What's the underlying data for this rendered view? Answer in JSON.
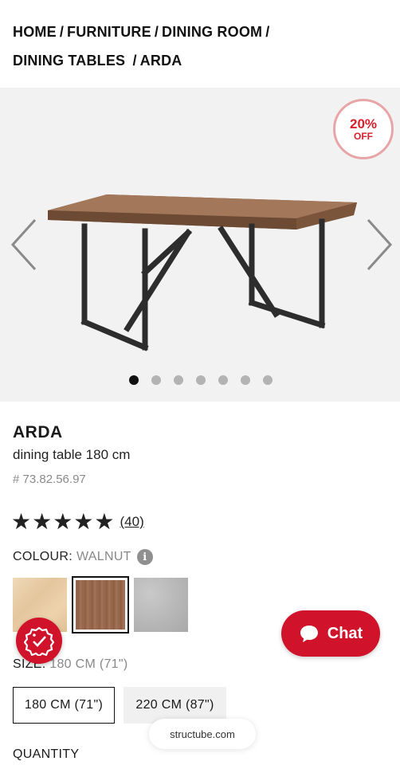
{
  "breadcrumb": {
    "items": [
      "HOME",
      "FURNITURE",
      "DINING ROOM",
      "DINING TABLES",
      "ARDA"
    ],
    "separator": "/"
  },
  "gallery": {
    "discount_badge": {
      "percent": "20%",
      "label": "OFF",
      "color": "#d81f2a"
    },
    "image_count": 7,
    "active_index": 0,
    "prev_icon": "chevron-left-icon",
    "next_icon": "chevron-right-icon"
  },
  "product": {
    "name": "ARDA",
    "description": "dining table 180 cm",
    "sku": "# 73.82.56.97",
    "rating": {
      "stars": "★★★★★",
      "value": 5,
      "reviews": "(40)"
    }
  },
  "colour": {
    "label": "COLOUR:",
    "selected": "WALNUT",
    "info_icon": "info-icon",
    "swatches": [
      {
        "name": "oak",
        "selected": false
      },
      {
        "name": "walnut",
        "selected": true
      },
      {
        "name": "concrete",
        "selected": false
      }
    ]
  },
  "size": {
    "label": "SIZE:",
    "selected": "180 CM (71\")",
    "options": [
      "180 CM (71\")",
      "220 CM (87\")"
    ]
  },
  "quantity": {
    "label": "QUANTITY"
  },
  "chat": {
    "label": "Chat",
    "icon": "chat-bubble-icon",
    "color": "#d0132a"
  },
  "promo": {
    "icon": "discount-check-icon"
  },
  "browser": {
    "url": "structube.com"
  }
}
